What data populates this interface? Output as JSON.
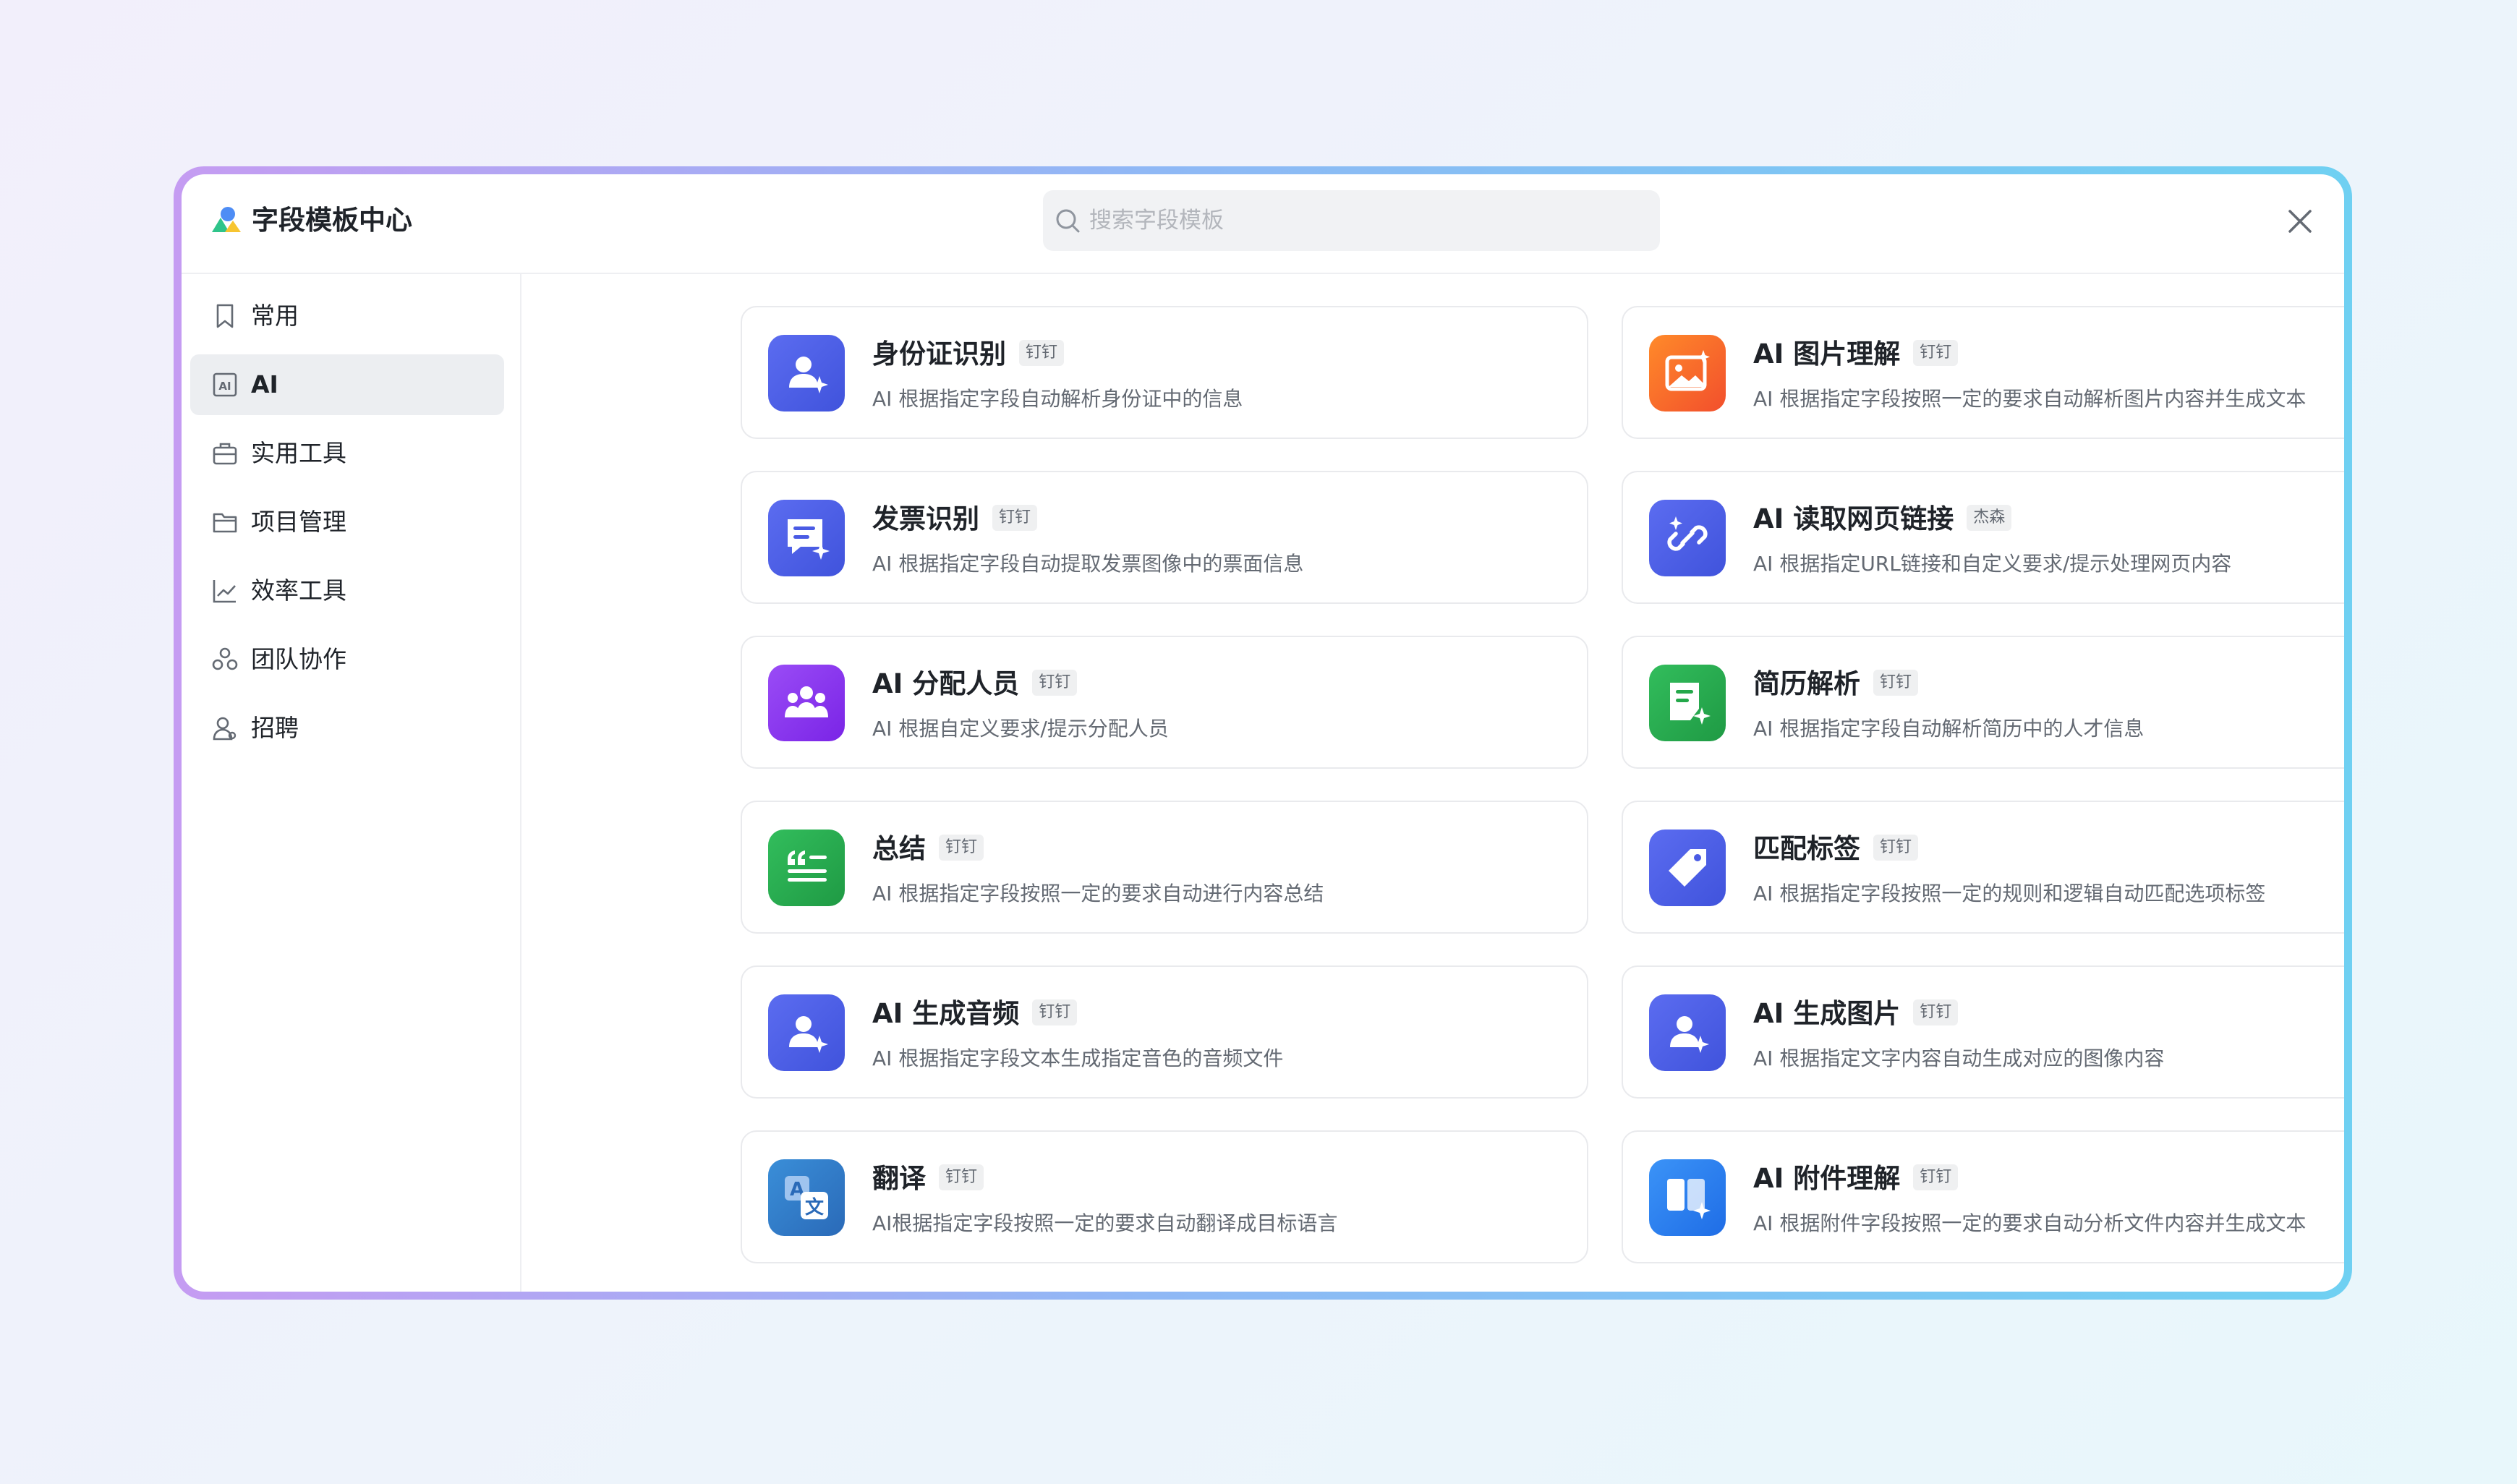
{
  "header": {
    "title": "字段模板中心",
    "search_placeholder": "搜索字段模板"
  },
  "sidebar": {
    "items": [
      {
        "label": "常用",
        "icon": "bookmark-icon",
        "active": false
      },
      {
        "label": "AI",
        "icon": "ai-icon",
        "active": true
      },
      {
        "label": "实用工具",
        "icon": "toolbox-icon",
        "active": false
      },
      {
        "label": "项目管理",
        "icon": "folder-icon",
        "active": false
      },
      {
        "label": "效率工具",
        "icon": "trend-chart-icon",
        "active": false
      },
      {
        "label": "团队协作",
        "icon": "team-icon",
        "active": false
      },
      {
        "label": "招聘",
        "icon": "recruit-icon",
        "active": false
      }
    ]
  },
  "cards": [
    {
      "title": "身份证识别",
      "tag": "钉钉",
      "desc": "AI 根据指定字段自动解析身份证中的信息",
      "icon": "id-card-person-icon",
      "color": "#4e5fe6"
    },
    {
      "title": "AI 图片理解",
      "tag": "钉钉",
      "desc": "AI 根据指定字段按照一定的要求自动解析图片内容并生成文本",
      "icon": "image-sparkle-icon",
      "color": "#f5612c"
    },
    {
      "title": "发票识别",
      "tag": "钉钉",
      "desc": "AI 根据指定字段自动提取发票图像中的票面信息",
      "icon": "invoice-icon",
      "color": "#4e5fe6"
    },
    {
      "title": "AI 读取网页链接",
      "tag": "杰森",
      "desc": "AI 根据指定URL链接和自定义要求/提示处理网页内容",
      "icon": "link-sparkle-icon",
      "color": "#4e5fe6"
    },
    {
      "title": "AI 分配人员",
      "tag": "钉钉",
      "desc": "AI 根据自定义要求/提示分配人员",
      "icon": "group-icon",
      "color": "#8a35ee"
    },
    {
      "title": "简历解析",
      "tag": "钉钉",
      "desc": "AI 根据指定字段自动解析简历中的人才信息",
      "icon": "resume-icon",
      "color": "#24a84a"
    },
    {
      "title": "总结",
      "tag": "钉钉",
      "desc": "AI 根据指定字段按照一定的要求自动进行内容总结",
      "icon": "quote-lines-icon",
      "color": "#24a84a"
    },
    {
      "title": "匹配标签",
      "tag": "钉钉",
      "desc": "AI 根据指定字段按照一定的规则和逻辑自动匹配选项标签",
      "icon": "tag-icon",
      "color": "#4e5fe6"
    },
    {
      "title": "AI 生成音频",
      "tag": "钉钉",
      "desc": "AI 根据指定字段文本生成指定音色的音频文件",
      "icon": "audio-person-icon",
      "color": "#4e5fe6"
    },
    {
      "title": "AI 生成图片",
      "tag": "钉钉",
      "desc": "AI 根据指定文字内容自动生成对应的图像内容",
      "icon": "image-person-icon",
      "color": "#4e5fe6"
    },
    {
      "title": "翻译",
      "tag": "钉钉",
      "desc": "AI根据指定字段按照一定的要求自动翻译成目标语言",
      "icon": "translate-icon",
      "color": "#2d78c8"
    },
    {
      "title": "AI 附件理解",
      "tag": "钉钉",
      "desc": "AI 根据附件字段按照一定的要求自动分析文件内容并生成文本",
      "icon": "attachment-book-icon",
      "color": "#2a7ff0"
    }
  ]
}
